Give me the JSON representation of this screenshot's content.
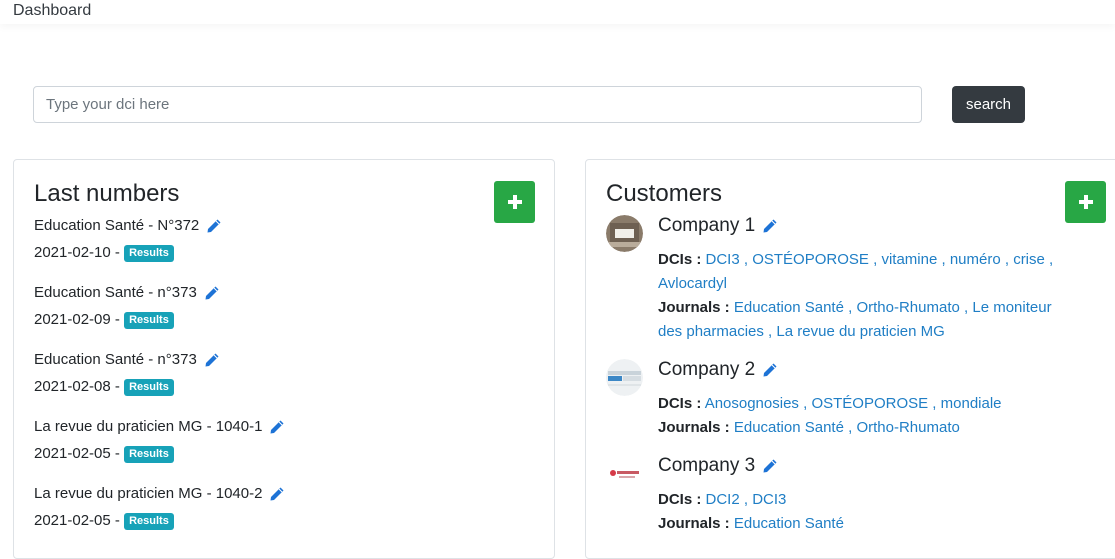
{
  "header": {
    "title": "Dashboard"
  },
  "search": {
    "placeholder": "Type your dci here",
    "button_label": "search"
  },
  "last_numbers": {
    "title": "Last numbers",
    "add_label": "+",
    "items": [
      {
        "name": "Education Santé - N°372",
        "date": "2021-02-10",
        "badge": "Results"
      },
      {
        "name": "Education Santé - n°373",
        "date": "2021-02-09",
        "badge": "Results"
      },
      {
        "name": "Education Santé - n°373",
        "date": "2021-02-08",
        "badge": "Results"
      },
      {
        "name": "La revue du praticien MG - 1040-1",
        "date": "2021-02-05",
        "badge": "Results"
      },
      {
        "name": "La revue du praticien MG - 1040-2",
        "date": "2021-02-05",
        "badge": "Results"
      }
    ]
  },
  "customers": {
    "title": "Customers",
    "add_label": "+",
    "dcis_label": "DCIs :",
    "journals_label": "Journals :",
    "items": [
      {
        "name": "Company 1",
        "dcis": [
          "DCI3",
          "OSTÉOPOROSE",
          "vitamine",
          "numéro",
          "crise",
          "Avlocardyl"
        ],
        "journals": [
          "Education Santé",
          "Ortho-Rhumato",
          "Le moniteur des pharmacies",
          "La revue du praticien MG"
        ]
      },
      {
        "name": "Company 2",
        "dcis": [
          "Anosognosies",
          "OSTÉOPOROSE",
          "mondiale"
        ],
        "journals": [
          "Education Santé",
          "Ortho-Rhumato"
        ]
      },
      {
        "name": "Company 3",
        "dcis": [
          "DCI2",
          "DCI3"
        ],
        "journals": [
          "Education Santé"
        ]
      }
    ]
  },
  "colors": {
    "add_button": "#28a745",
    "search_button": "#343a40",
    "badge": "#17a2b8",
    "link": "#1f7ec5",
    "pencil": "#1d73d6"
  }
}
